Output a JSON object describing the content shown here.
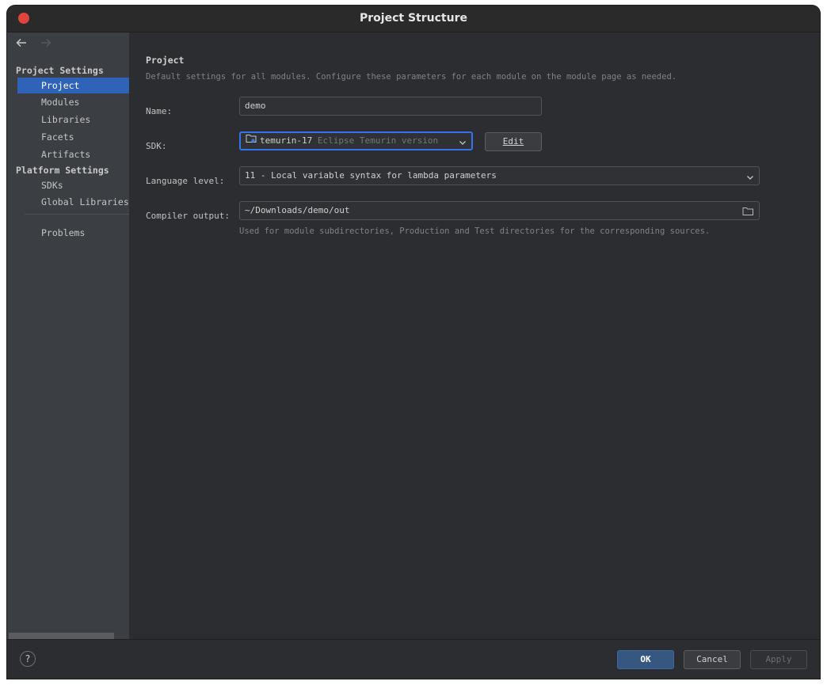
{
  "window": {
    "title": "Project Structure"
  },
  "sidebar": {
    "sections": [
      {
        "header": "Project Settings",
        "items": [
          "Project",
          "Modules",
          "Libraries",
          "Facets",
          "Artifacts"
        ]
      },
      {
        "header": "Platform Settings",
        "items": [
          "SDKs",
          "Global Libraries"
        ]
      }
    ],
    "problems": "Problems",
    "selected": "Project"
  },
  "main": {
    "heading": "Project",
    "description": "Default settings for all modules. Configure these parameters for each module on the module page as needed.",
    "name": {
      "label": "Name:",
      "value": "demo"
    },
    "sdk": {
      "label": "SDK:",
      "value": "temurin-17",
      "version": "Eclipse Temurin version",
      "edit_label": "Edit"
    },
    "language_level": {
      "label": "Language level:",
      "value": "11 - Local variable syntax for lambda parameters"
    },
    "compiler_output": {
      "label": "Compiler output:",
      "value": "~/Downloads/demo/out",
      "hint": "Used for module subdirectories, Production and Test directories for the corresponding sources."
    }
  },
  "footer": {
    "help": "?",
    "ok": "OK",
    "cancel": "Cancel",
    "apply": "Apply"
  },
  "colors": {
    "accent": "#3574f0",
    "selection": "#2e63b8",
    "close": "#e0443e"
  }
}
